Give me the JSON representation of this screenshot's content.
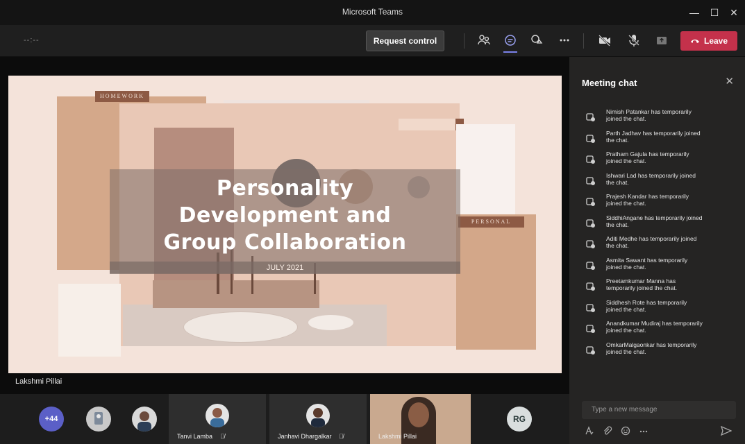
{
  "window": {
    "title": "Microsoft Teams",
    "controls": [
      "—",
      "☐",
      "✕"
    ]
  },
  "toolbar": {
    "timer": "--:--",
    "request_control": "Request control",
    "leave": "Leave",
    "icons": [
      "participants-icon",
      "chat-icon",
      "reactions-icon",
      "more-icon",
      "camera-off-icon",
      "mic-off-icon",
      "share-icon"
    ]
  },
  "slide": {
    "title_lines": [
      "Personality",
      "Development and",
      "Group Collaboration"
    ],
    "date": "JULY 2021",
    "tag_homework": "HOMEWORK",
    "tag_personal": "PERSONAL"
  },
  "presenter": {
    "name": "Lakshmi Pillai"
  },
  "chat": {
    "title": "Meeting chat",
    "messages": [
      "Nimish Patankar has temporarily joined the chat.",
      "Parth Jadhav has temporarily joined the chat.",
      "Pratham Gajula has temporarily joined the chat.",
      "Ishwari Lad has temporarily joined the chat.",
      "Prajesh Kandar has temporarily joined the chat.",
      "SiddhiAngane has temporarily joined the chat.",
      "Aditi Medhe has temporarily joined the chat.",
      "Asmita Sawant has temporarily joined the chat.",
      "Preetamkumar Manna has temporarily joined the chat.",
      "Siddhesh Rote has temporarily joined the chat.",
      "Anandkumar Mudiraj has temporarily joined the chat.",
      "OmkarMalgaonkar has temporarily joined the chat."
    ],
    "composer_placeholder": "Type a new message"
  },
  "gallery": {
    "overflow_count": "+44",
    "initials": "RG",
    "participants": [
      {
        "name": "Tanvi Lamba"
      },
      {
        "name": "Janhavi Dhargalkar"
      },
      {
        "name": "Lakshmi Pillai"
      }
    ]
  },
  "colors": {
    "accent": "#7b83eb",
    "leave": "#c4314b",
    "avatar_overflow": "#5b5fc7",
    "avatar_rg": "#d9dede"
  }
}
